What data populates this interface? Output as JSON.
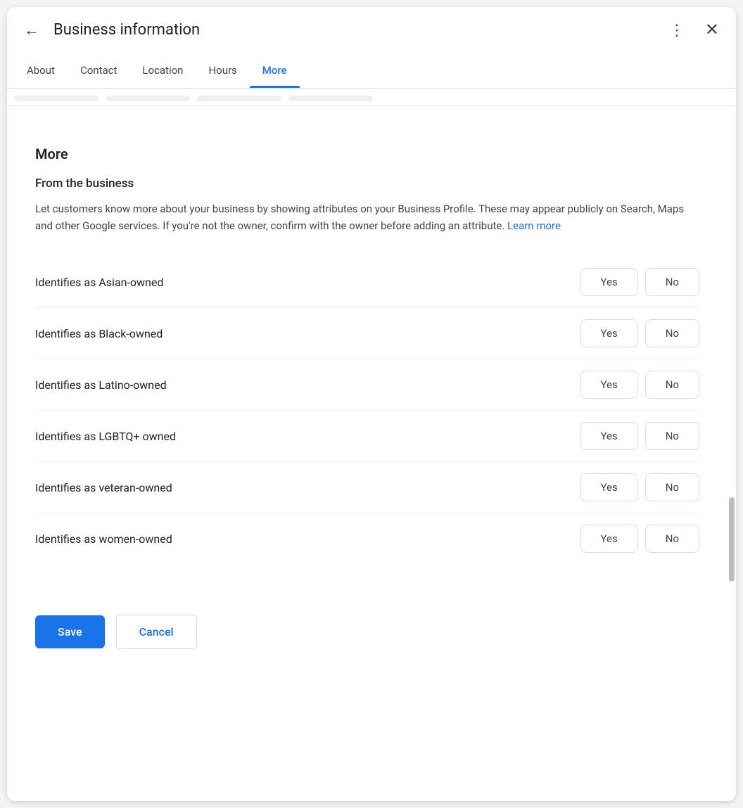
{
  "header": {
    "title": "Business information",
    "back_label": "←",
    "more_label": "⋮",
    "close_label": "✕"
  },
  "tabs": [
    {
      "id": "about",
      "label": "About",
      "active": false
    },
    {
      "id": "contact",
      "label": "Contact",
      "active": false
    },
    {
      "id": "location",
      "label": "Location",
      "active": false
    },
    {
      "id": "hours",
      "label": "Hours",
      "active": false
    },
    {
      "id": "more",
      "label": "More",
      "active": true
    }
  ],
  "section": {
    "title": "More",
    "from_biz_title": "From the business",
    "description_main": "Let customers know more about your business by showing attributes on your Business Profile. These may appear publicly on Search, Maps and other Google services. If you're not the owner, confirm with the owner before adding an attribute.",
    "learn_more_label": "Learn more"
  },
  "attributes": [
    {
      "label": "Identifies as Asian-owned",
      "yes": "Yes",
      "no": "No"
    },
    {
      "label": "Identifies as Black-owned",
      "yes": "Yes",
      "no": "No"
    },
    {
      "label": "Identifies as Latino-owned",
      "yes": "Yes",
      "no": "No"
    },
    {
      "label": "Identifies as LGBTQ+ owned",
      "yes": "Yes",
      "no": "No"
    },
    {
      "label": "Identifies as veteran-owned",
      "yes": "Yes",
      "no": "No"
    },
    {
      "label": "Identifies as women-owned",
      "yes": "Yes",
      "no": "No"
    }
  ],
  "actions": {
    "save_label": "Save",
    "cancel_label": "Cancel"
  }
}
